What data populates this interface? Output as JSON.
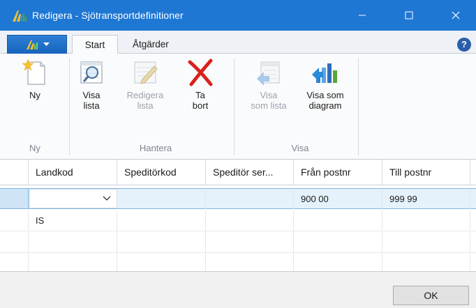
{
  "window": {
    "title": "Redigera - Sjötransportdefinitioner",
    "accent_color": "#1f77d4"
  },
  "ribbon": {
    "tabs": [
      {
        "label": "Start",
        "selected": true
      },
      {
        "label": "Åtgärder",
        "selected": false
      }
    ],
    "help_label": "?",
    "groups": [
      {
        "label": "Ny",
        "buttons": [
          {
            "label": "Ny",
            "icon": "new-document-icon",
            "enabled": true
          }
        ]
      },
      {
        "label": "Hantera",
        "buttons": [
          {
            "label": "Visa\nlista",
            "icon": "view-list-icon",
            "enabled": true
          },
          {
            "label": "Redigera\nlista",
            "icon": "edit-list-icon",
            "enabled": false
          },
          {
            "label": "Ta\nbort",
            "icon": "delete-x-icon",
            "enabled": true
          }
        ]
      },
      {
        "label": "Visa",
        "buttons": [
          {
            "label": "Visa\nsom lista",
            "icon": "show-as-list-icon",
            "enabled": false
          },
          {
            "label": "Visa som\ndiagram",
            "icon": "show-as-chart-icon",
            "enabled": true
          }
        ]
      }
    ]
  },
  "grid": {
    "columns": [
      "Landkod",
      "Speditörkod",
      "Speditör ser...",
      "Från postnr",
      "Till postnr"
    ],
    "rows": [
      {
        "landkod": "",
        "speditorkod": "",
        "speditor_ser": "",
        "fran_postnr": "900 00",
        "till_postnr": "999 99",
        "selected": true
      },
      {
        "landkod": "IS",
        "speditorkod": "",
        "speditor_ser": "",
        "fran_postnr": "",
        "till_postnr": "",
        "selected": false
      },
      {
        "landkod": "",
        "speditorkod": "",
        "speditor_ser": "",
        "fran_postnr": "",
        "till_postnr": "",
        "selected": false
      }
    ]
  },
  "footer": {
    "ok_label": "OK"
  }
}
